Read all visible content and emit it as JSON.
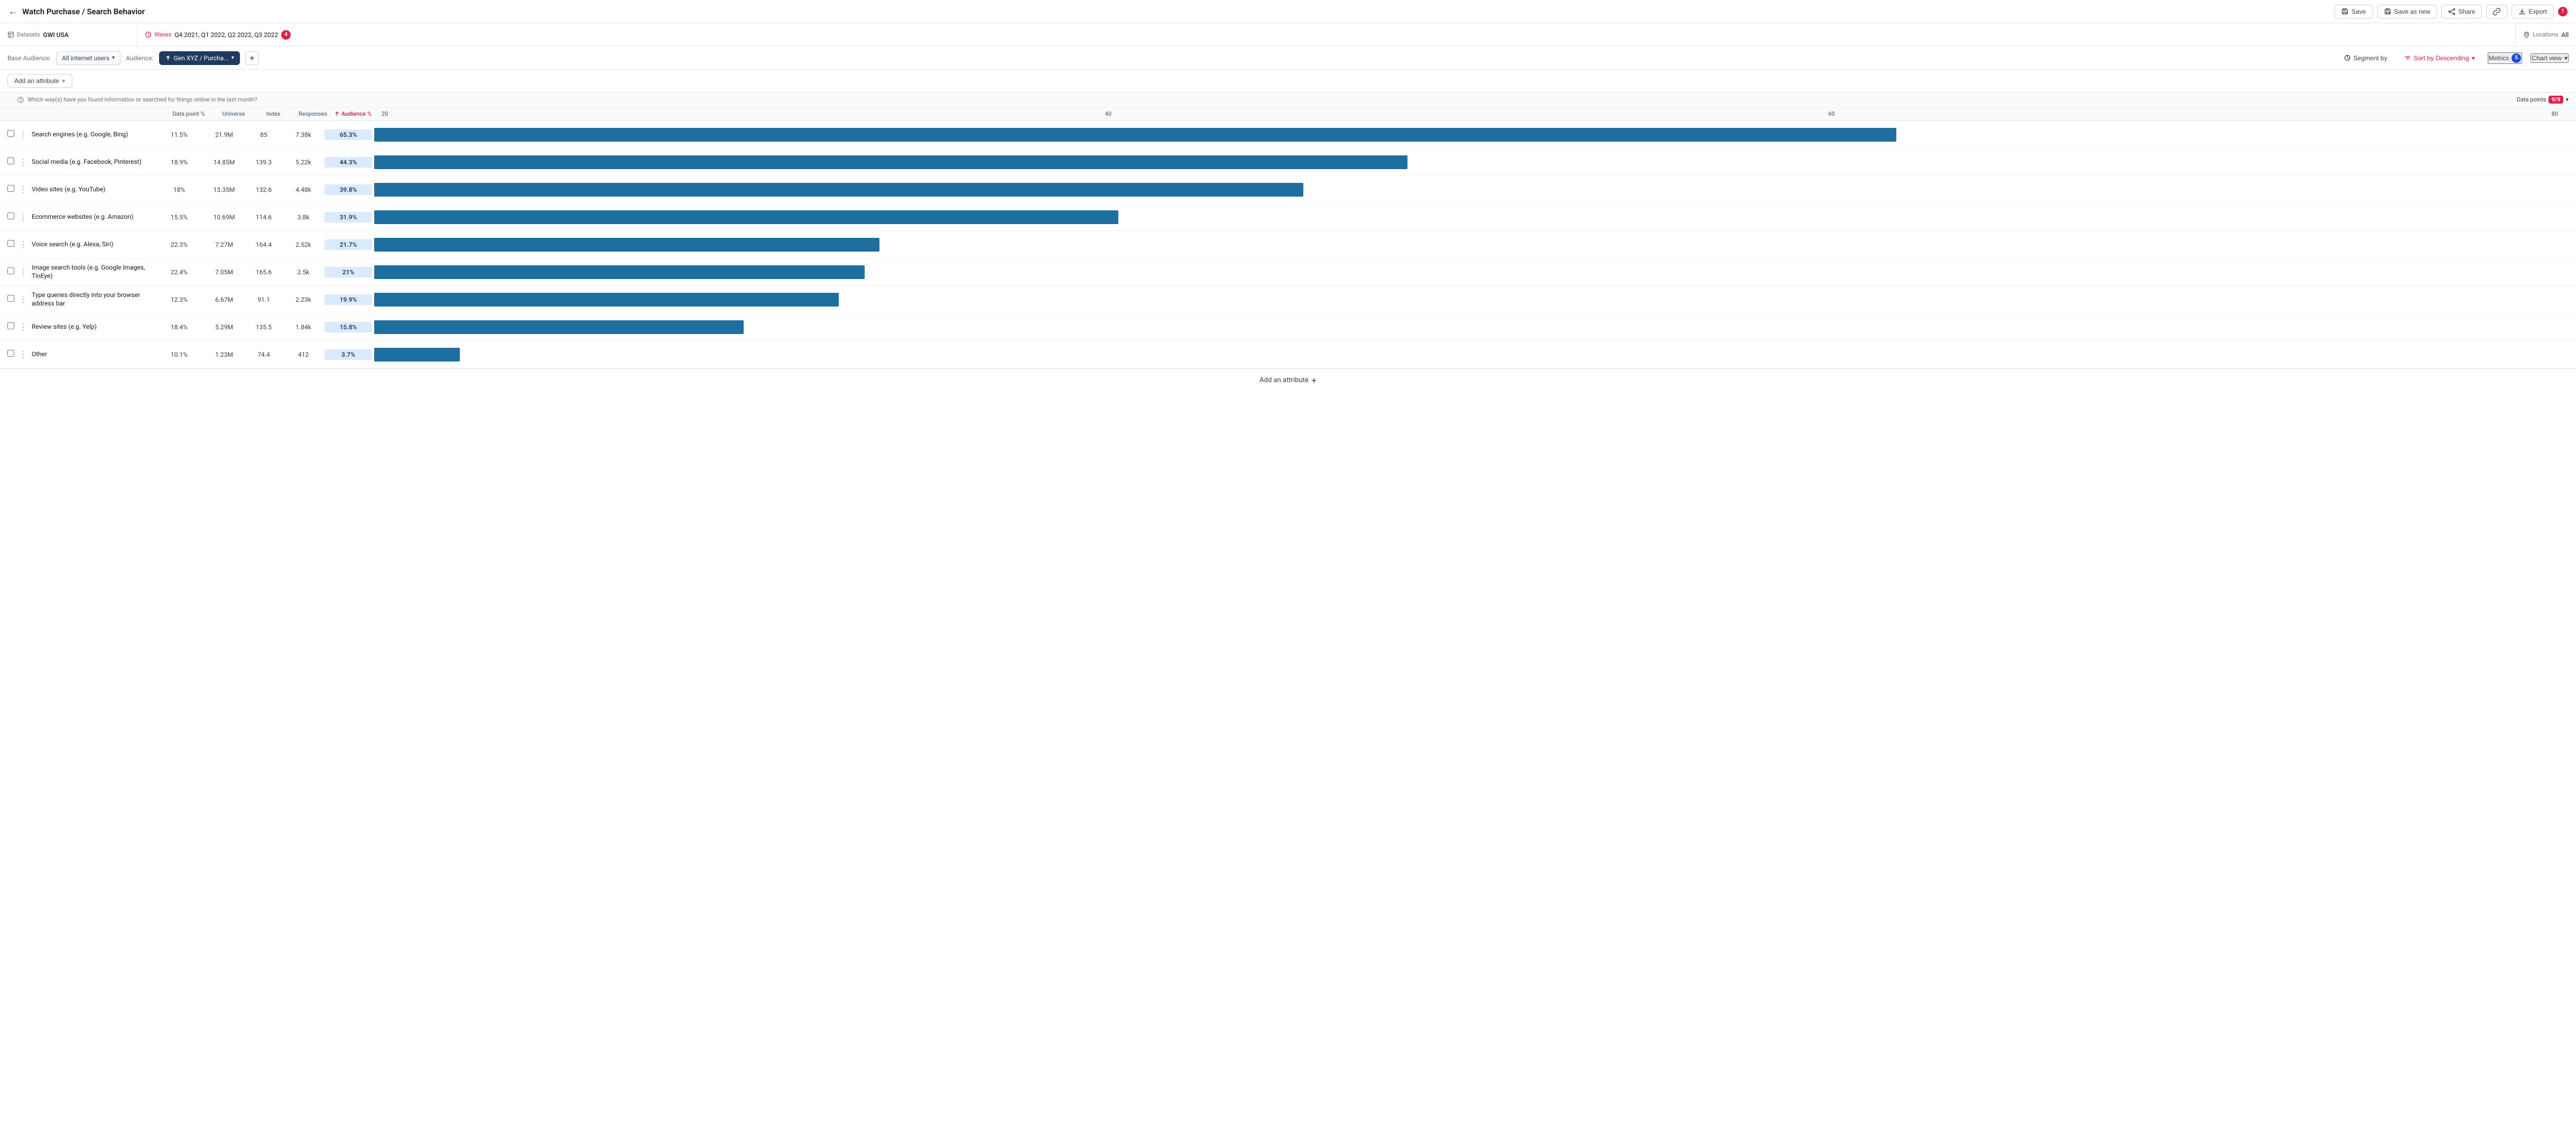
{
  "header": {
    "title": "Watch Purchase / Search Behavior",
    "back_label": "←",
    "save_label": "Save",
    "save_as_new_label": "Save as new",
    "share_label": "Share",
    "link_label": "🔗",
    "export_label": "Export",
    "notification_badge": "1"
  },
  "filter_bar": {
    "datasets_label": "Datasets",
    "datasets_value": "GWI USA",
    "waves_label": "Waves",
    "waves_value": "Q4 2021, Q1 2022, Q2 2022, Q3 2022",
    "waves_badge": "4",
    "locations_label": "Locations",
    "locations_value": "All"
  },
  "audience_bar": {
    "base_audience_label": "Base Audience:",
    "audience_label": "Audience:",
    "base_chip_label": "All internet users",
    "audience_chip_label": "Gen XYZ / Purcha...",
    "add_audience_label": "+",
    "segment_by_label": "Segment by",
    "sort_by_label": "Sort by Descending",
    "metrics_label": "Metrics",
    "metrics_count": "5",
    "chart_view_label": "Chart view"
  },
  "toolbar": {
    "add_attribute_label": "Add an attribute",
    "add_icon": "+"
  },
  "question": {
    "text": "Which way(s) have you found information or searched for things online in the last month?",
    "data_points_label": "Data points",
    "data_points_count": "9/9"
  },
  "columns": {
    "data_point": "Data point %",
    "universe": "Universe",
    "index": "Index",
    "responses": "Responses",
    "audience_pct": "Audience %"
  },
  "axis_labels": [
    "20",
    "40",
    "60",
    "80"
  ],
  "rows": [
    {
      "id": 1,
      "label": "Search engines (e.g. Google, Bing)",
      "data_point": "11.5%",
      "universe": "21.9M",
      "index": "85",
      "responses": "7.38k",
      "audience_pct": "65.3%",
      "bar_width_pct": 81.6
    },
    {
      "id": 2,
      "label": "Social media (e.g. Facebook, Pinterest)",
      "data_point": "18.9%",
      "universe": "14.85M",
      "index": "139.3",
      "responses": "5.22k",
      "audience_pct": "44.3%",
      "bar_width_pct": 55.4
    },
    {
      "id": 3,
      "label": "Video sites (e.g. YouTube)",
      "data_point": "18%",
      "universe": "13.35M",
      "index": "132.6",
      "responses": "4.48k",
      "audience_pct": "39.8%",
      "bar_width_pct": 49.8
    },
    {
      "id": 4,
      "label": "Ecommerce websites (e.g. Amazon)",
      "data_point": "15.5%",
      "universe": "10.69M",
      "index": "114.6",
      "responses": "3.8k",
      "audience_pct": "31.9%",
      "bar_width_pct": 39.9
    },
    {
      "id": 5,
      "label": "Voice search (e.g. Alexa, Siri)",
      "data_point": "22.3%",
      "universe": "7.27M",
      "index": "164.4",
      "responses": "2.52k",
      "audience_pct": "21.7%",
      "bar_width_pct": 27.1
    },
    {
      "id": 6,
      "label": "Image search tools (e.g. Google Images, TinEye)",
      "data_point": "22.4%",
      "universe": "7.05M",
      "index": "165.6",
      "responses": "2.5k",
      "audience_pct": "21%",
      "bar_width_pct": 26.3
    },
    {
      "id": 7,
      "label": "Type queries directly into your browser address bar",
      "data_point": "12.3%",
      "universe": "6.67M",
      "index": "91.1",
      "responses": "2.23k",
      "audience_pct": "19.9%",
      "bar_width_pct": 24.9
    },
    {
      "id": 8,
      "label": "Review sites (e.g. Yelp)",
      "data_point": "18.4%",
      "universe": "5.29M",
      "index": "135.5",
      "responses": "1.84k",
      "audience_pct": "15.8%",
      "bar_width_pct": 19.8
    },
    {
      "id": 9,
      "label": "Other",
      "data_point": "10.1%",
      "universe": "1.23M",
      "index": "74.4",
      "responses": "412",
      "audience_pct": "3.7%",
      "bar_width_pct": 4.6
    }
  ],
  "footer": {
    "add_attribute_label": "Add an attribute",
    "add_icon": "+"
  },
  "colors": {
    "bar": "#1e6fa0",
    "audience_bg": "#dbeafe",
    "audience_text": "#1e3a5f",
    "accent": "#e11d48",
    "primary_dark": "#1e3a5f"
  }
}
